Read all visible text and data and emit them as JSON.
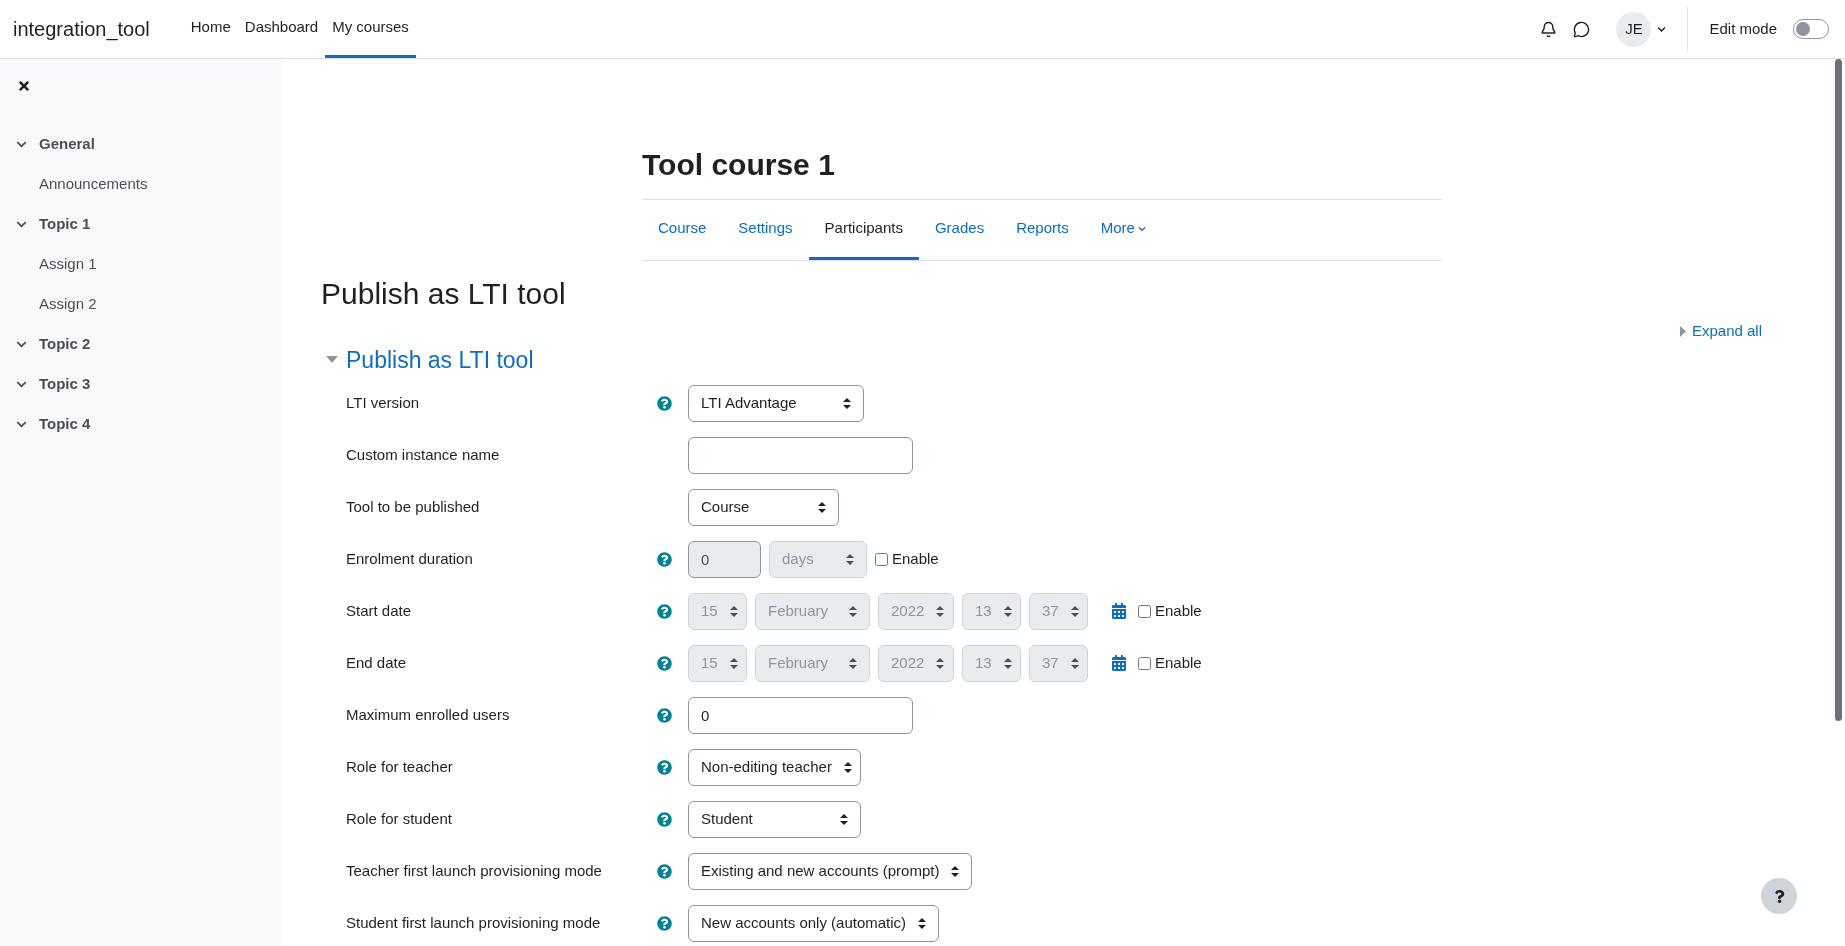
{
  "navbar": {
    "brand": "integration_tool",
    "links": [
      {
        "label": "Home",
        "selected": false
      },
      {
        "label": "Dashboard",
        "selected": false
      },
      {
        "label": "My courses",
        "selected": true
      }
    ],
    "avatar": "JE",
    "edit_mode": {
      "label": "Edit mode",
      "on": false
    }
  },
  "sidebar": {
    "items": [
      {
        "label": "General",
        "expanded": true,
        "children": [
          {
            "label": "Announcements"
          }
        ]
      },
      {
        "label": "Topic 1",
        "expanded": true,
        "children": [
          {
            "label": "Assign 1"
          },
          {
            "label": "Assign 2"
          }
        ]
      },
      {
        "label": "Topic 2",
        "expanded": true
      },
      {
        "label": "Topic 3",
        "expanded": true
      },
      {
        "label": "Topic 4",
        "expanded": true
      }
    ]
  },
  "course": {
    "title": "Tool course 1",
    "tabs": [
      {
        "label": "Course",
        "selected": false
      },
      {
        "label": "Settings",
        "selected": false
      },
      {
        "label": "Participants",
        "selected": true
      },
      {
        "label": "Grades",
        "selected": false
      },
      {
        "label": "Reports",
        "selected": false
      },
      {
        "label": "More",
        "selected": false,
        "kind": "menu"
      }
    ]
  },
  "page_title": "Publish as LTI tool",
  "expand_all": "Expand all",
  "section": {
    "title": "Publish as LTI tool",
    "expanded": true,
    "fields": [
      {
        "kind": "select",
        "label": "LTI version",
        "help": true,
        "value": "LTI Advantage"
      },
      {
        "kind": "text",
        "label": "Custom instance name",
        "help": false
      },
      {
        "kind": "select",
        "label": "Tool to be published",
        "help": false,
        "value": "Course"
      },
      {
        "kind": "duration",
        "label": "Enrolment duration",
        "help": true,
        "value": "0",
        "unit": "days",
        "disabled": true,
        "enable": {
          "label": "Enable",
          "checked": false
        }
      },
      {
        "kind": "date",
        "label": "Start date",
        "help": true,
        "parts": [
          "15",
          "February",
          "2022",
          "13",
          "37"
        ],
        "disabled": true,
        "enable": {
          "label": "Enable",
          "checked": false
        }
      },
      {
        "kind": "date",
        "label": "End date",
        "help": true,
        "parts": [
          "15",
          "February",
          "2022",
          "13",
          "37"
        ],
        "disabled": true,
        "enable": {
          "label": "Enable",
          "checked": false
        }
      },
      {
        "kind": "text",
        "label": "Maximum enrolled users",
        "help": true,
        "value": "0"
      },
      {
        "kind": "select",
        "label": "Role for teacher",
        "help": true,
        "value": "Non-editing teacher"
      },
      {
        "kind": "select",
        "label": "Role for student",
        "help": true,
        "value": "Student"
      },
      {
        "kind": "select",
        "label": "Teacher first launch provisioning mode",
        "help": true,
        "value": "Existing and new accounts (prompt)"
      },
      {
        "kind": "select",
        "label": "Student first launch provisioning mode",
        "help": true,
        "value": "New accounts only (automatic)"
      }
    ]
  }
}
